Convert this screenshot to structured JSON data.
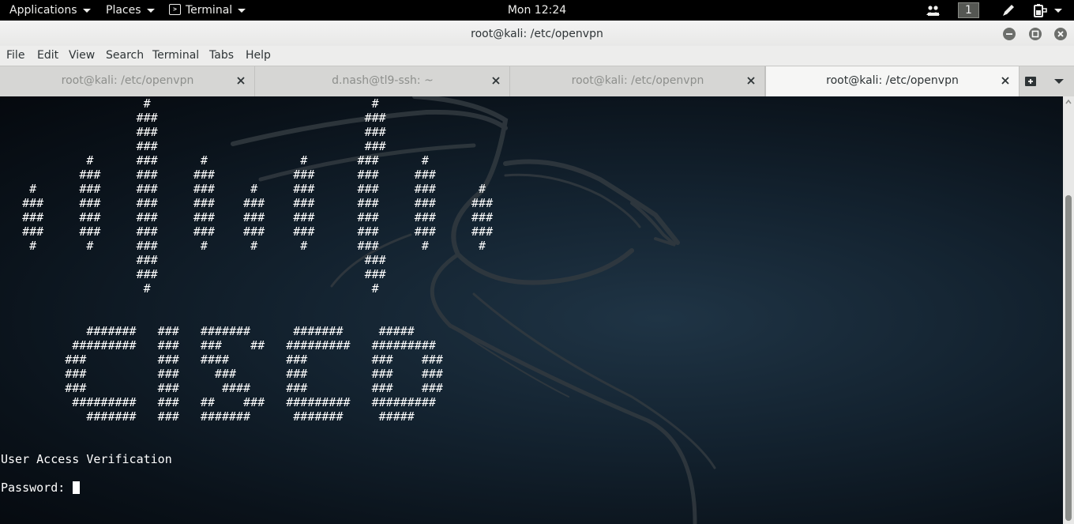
{
  "topbar": {
    "applications_label": "Applications",
    "places_label": "Places",
    "app_label": "Terminal",
    "clock": "Mon 12:24",
    "workspace_number": "1"
  },
  "window": {
    "title": "root@kali: /etc/openvpn"
  },
  "menubar": {
    "items": [
      "File",
      "Edit",
      "View",
      "Search",
      "Terminal",
      "Tabs",
      "Help"
    ]
  },
  "tabs": [
    {
      "label": "root@kali: /etc/openvpn",
      "active": false
    },
    {
      "label": "d.nash@tl9-ssh: ~",
      "active": false
    },
    {
      "label": "root@kali: /etc/openvpn",
      "active": false
    },
    {
      "label": "root@kali: /etc/openvpn",
      "active": true
    }
  ],
  "terminal": {
    "banner_lines": [
      "                    #                               #",
      "                   ###                             ###",
      "                   ###                             ###",
      "                   ###                             ###",
      "            #      ###      #             #       ###      #",
      "           ###     ###     ###           ###      ###     ###",
      "    #      ###     ###     ###     #     ###      ###     ###      #",
      "   ###     ###     ###     ###    ###    ###      ###     ###     ###",
      "   ###     ###     ###     ###    ###    ###      ###     ###     ###",
      "   ###     ###     ###     ###    ###    ###      ###     ###     ###",
      "    #       #      ###      #      #      #       ###      #       #",
      "                   ###                             ###",
      "                   ###                             ###",
      "                    #                               #",
      "",
      "",
      "            #######   ###   #######      #######     #####",
      "          #########   ###   ###    ##   #########   #########",
      "         ###          ###   ####        ###         ###    ###",
      "         ###          ###     ###       ###         ###    ###",
      "         ###          ###      ####     ###         ###    ###",
      "          #########   ###   ##    ###   #########   #########",
      "            #######   ###   #######      #######     #####",
      "",
      "",
      "User Access Verification",
      ""
    ],
    "prompt": "Password: "
  },
  "colors": {
    "topbar_bg": "#000000",
    "titlebar_bg": "#e8e8e7",
    "terminal_fg": "#ffffff",
    "terminal_bg": "#0a121a"
  }
}
